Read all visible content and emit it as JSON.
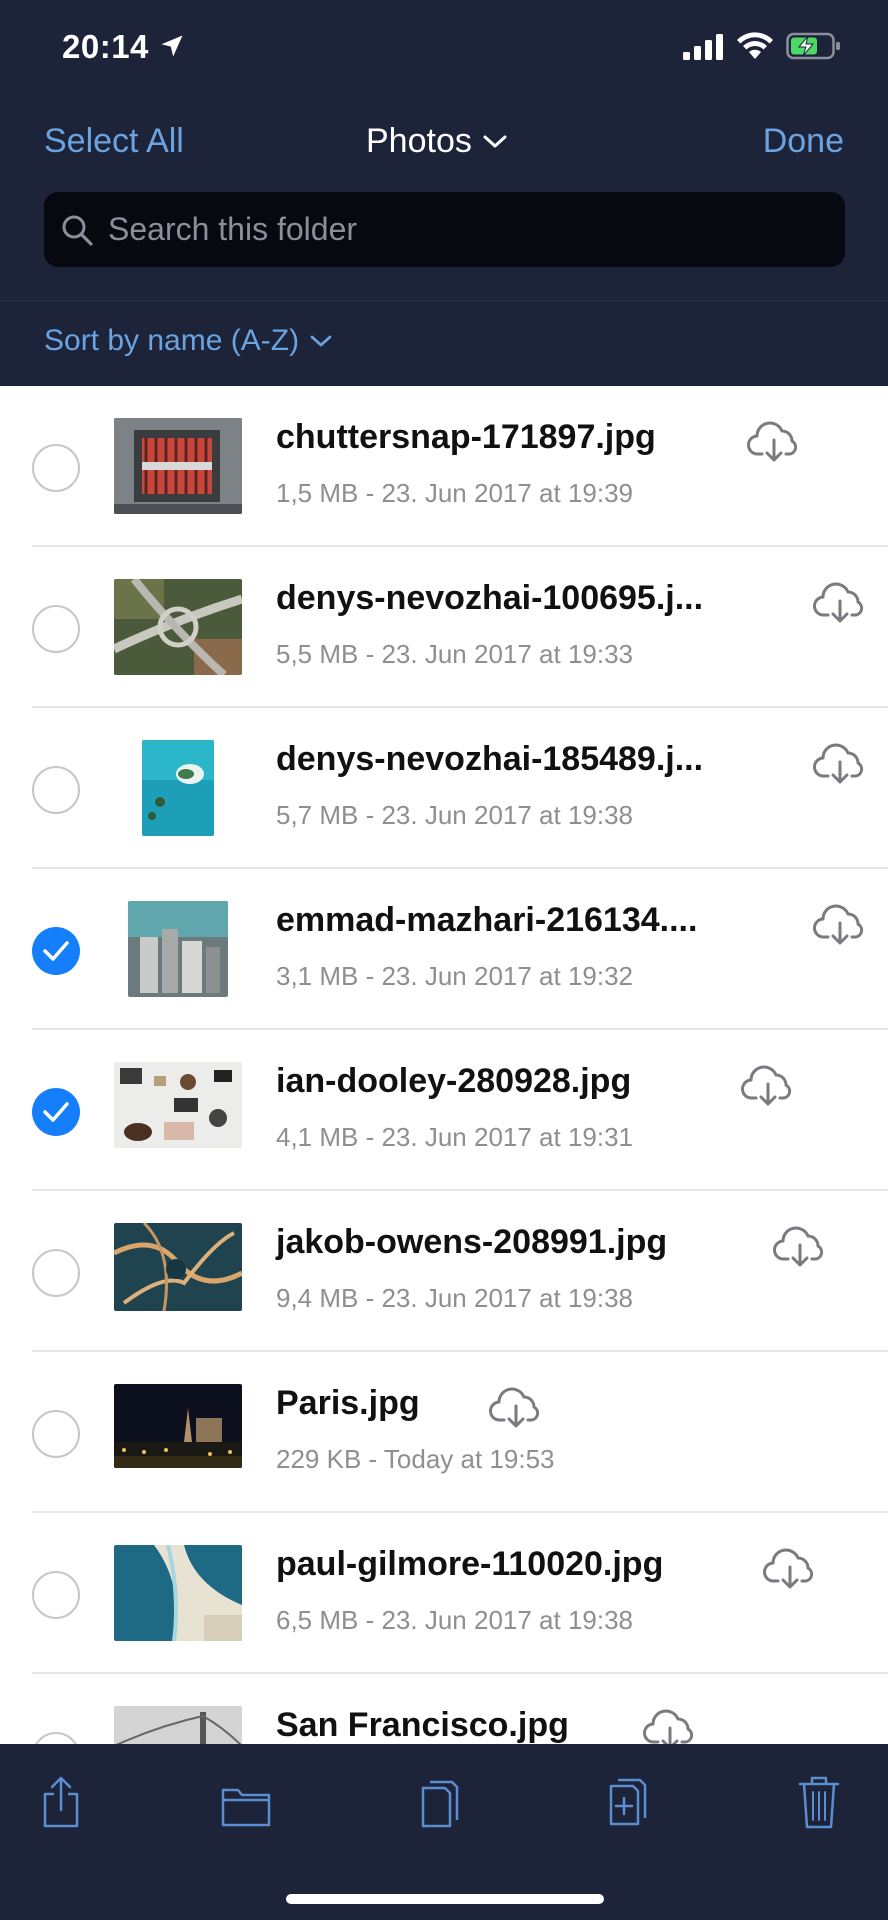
{
  "status_bar": {
    "time": "20:14"
  },
  "nav": {
    "select_all": "Select All",
    "title": "Photos",
    "done": "Done"
  },
  "search": {
    "placeholder": "Search this folder",
    "value": ""
  },
  "sort": {
    "label": "Sort by name (A-Z)"
  },
  "files": [
    {
      "name": "chuttersnap-171897.jpg",
      "meta": "1,5 MB - 23. Jun 2017 at 19:39",
      "selected": false
    },
    {
      "name": "denys-nevozhai-100695.j...",
      "meta": "5,5 MB - 23. Jun 2017 at 19:33",
      "selected": false
    },
    {
      "name": "denys-nevozhai-185489.j...",
      "meta": "5,7 MB - 23. Jun 2017 at 19:38",
      "selected": false
    },
    {
      "name": "emmad-mazhari-216134....",
      "meta": "3,1 MB - 23. Jun 2017 at 19:32",
      "selected": true
    },
    {
      "name": "ian-dooley-280928.jpg",
      "meta": "4,1 MB - 23. Jun 2017 at 19:31",
      "selected": true
    },
    {
      "name": "jakob-owens-208991.jpg",
      "meta": "9,4 MB - 23. Jun 2017 at 19:38",
      "selected": false
    },
    {
      "name": "Paris.jpg",
      "meta": "229 KB - Today at 19:53",
      "selected": false
    },
    {
      "name": "paul-gilmore-110020.jpg",
      "meta": "6,5 MB - 23. Jun 2017 at 19:38",
      "selected": false
    },
    {
      "name": "San Francisco.jpg",
      "meta": "",
      "selected": false
    }
  ],
  "toolbar": {
    "icons": [
      "share-icon",
      "folder-icon",
      "copy-icon",
      "duplicate-icon",
      "trash-icon"
    ]
  },
  "colors": {
    "accent": "#6aa3e0",
    "header_bg": "#1d2338",
    "selected": "#147efb"
  }
}
